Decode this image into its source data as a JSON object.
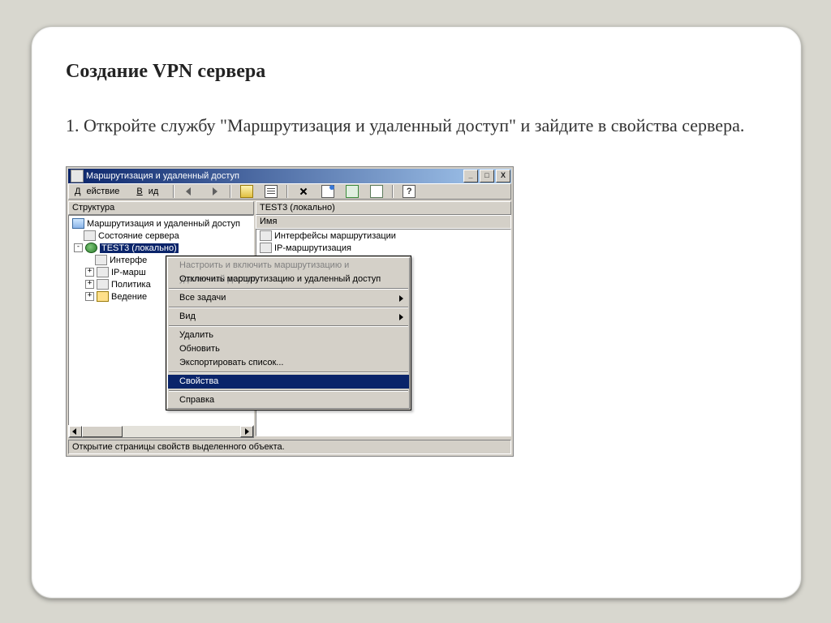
{
  "slide": {
    "title": "Создание VPN сервера",
    "text": "1. Откройте службу \"Маршрутизация и удаленный доступ\" и зайдите в свойства сервера."
  },
  "window": {
    "title": "Маршрутизация и удаленный доступ",
    "menu": {
      "action_underlined": "Д",
      "action_rest": "ействие",
      "view_underlined": "В",
      "view_rest": "ид"
    },
    "panels": {
      "structure_header": "Структура",
      "content_header": "TEST3 (локально)",
      "list_column": "Имя"
    },
    "tree": {
      "root": "Маршрутизация и удаленный доступ",
      "status": "Состояние сервера",
      "server": "TEST3 (локально)",
      "interfaces": "Интерфе",
      "iprouting": "IP-марш",
      "policy": "Политика",
      "logging": "Ведение"
    },
    "list": {
      "item1": "Интерфейсы маршрутизации",
      "item2": "IP-маршрутизация"
    },
    "status_text": "Открытие страницы свойств выделенного объекта."
  },
  "context_menu": {
    "configure": "Настроить и включить маршрутизацию и удаленный доступ",
    "disable": "Отключить маршрутизацию и удаленный доступ",
    "all_tasks": "Все задачи",
    "view": "Вид",
    "delete": "Удалить",
    "refresh": "Обновить",
    "export": "Экспортировать список...",
    "properties": "Свойства",
    "help": "Справка"
  },
  "buttons": {
    "min": "_",
    "max": "□",
    "close": "X",
    "help": "?"
  }
}
